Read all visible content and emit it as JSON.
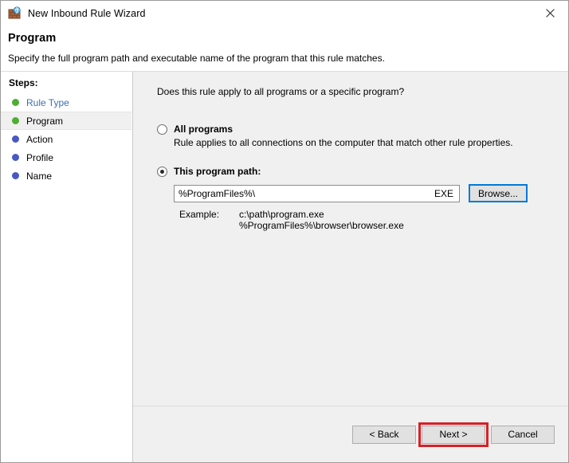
{
  "window": {
    "title": "New Inbound Rule Wizard",
    "app_icon": "firewall-globe-icon",
    "close_label": "✕"
  },
  "header": {
    "title": "Program",
    "description": "Specify the full program path and executable name of the program that this rule matches."
  },
  "sidebar": {
    "heading": "Steps:",
    "items": [
      {
        "label": "Rule Type",
        "bullet_color": "#4fae31",
        "state": "completed-link"
      },
      {
        "label": "Program",
        "bullet_color": "#4fae31",
        "state": "selected"
      },
      {
        "label": "Action",
        "bullet_color": "#4a58c4",
        "state": "pending"
      },
      {
        "label": "Profile",
        "bullet_color": "#4a58c4",
        "state": "pending"
      },
      {
        "label": "Name",
        "bullet_color": "#4a58c4",
        "state": "pending"
      }
    ]
  },
  "main": {
    "question": "Does this rule apply to all programs or a specific program?",
    "option_all": {
      "title": "All programs",
      "description": "Rule applies to all connections on the computer that match other rule properties.",
      "selected": false
    },
    "option_path": {
      "title": "This program path:",
      "selected": true,
      "field_value": "%ProgramFiles%\\",
      "field_suffix": "EXE",
      "browse_label": "Browse...",
      "example_label": "Example:",
      "example_lines": [
        "c:\\path\\program.exe",
        "%ProgramFiles%\\browser\\browser.exe"
      ]
    }
  },
  "footer": {
    "back_label": "< Back",
    "next_label": "Next >",
    "cancel_label": "Cancel",
    "highlight_color": "#d81f26",
    "highlighted_button": "next-button"
  }
}
